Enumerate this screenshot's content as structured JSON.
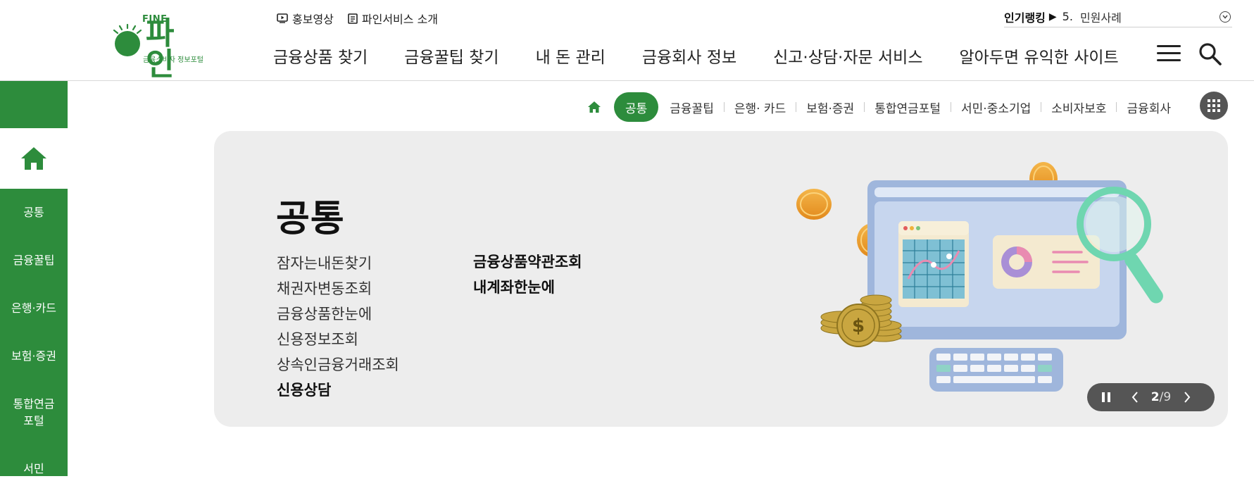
{
  "logo": {
    "fine": "FINE",
    "text": "파인",
    "sub": "금융소비자 정보포털"
  },
  "util": {
    "video": "홍보영상",
    "intro": "파인서비스 소개"
  },
  "gnb": [
    "금융상품 찾기",
    "금융꿀팁 찾기",
    "내 돈 관리",
    "금융회사 정보",
    "신고·상담·자문 서비스",
    "알아두면 유익한 사이트"
  ],
  "ranking": {
    "title": "인기랭킹",
    "arrow": "▶",
    "num": "5.",
    "text": "민원사례"
  },
  "sidebar": {
    "items": [
      "공통",
      "금융꿀팁",
      "은행·카드",
      "보험·증권",
      "통합연금\n포털",
      "서민"
    ]
  },
  "subtabs": [
    "공통",
    "금융꿀팁",
    "은행· 카드",
    "보험·증권",
    "통합연금포털",
    "서민·중소기업",
    "소비자보호",
    "금융회사"
  ],
  "banner": {
    "title": "공통",
    "col1": [
      "잠자는내돈찾기",
      "채권자변동조회",
      "금융상품한눈에",
      "신용정보조회",
      "상속인금융거래조회",
      "신용상담"
    ],
    "col2": [
      "금융상품약관조회",
      "내계좌한눈에"
    ],
    "current": "2",
    "total": "/9"
  },
  "colors": {
    "brand": "#2d8c3c",
    "control": "#555555",
    "banner_bg": "#ededed"
  },
  "icons": [
    "play-icon",
    "document-icon",
    "hamburger-icon",
    "search-icon",
    "home-icon",
    "grid-icon",
    "pause-icon",
    "chevron-left-icon",
    "chevron-right-icon",
    "chevron-down-icon"
  ]
}
